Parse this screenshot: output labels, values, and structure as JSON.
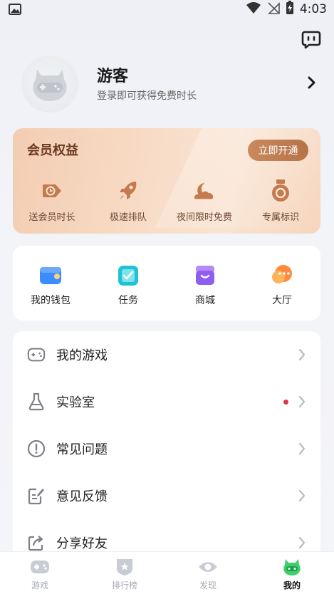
{
  "status_bar": {
    "time": "4:03"
  },
  "profile": {
    "username": "游客",
    "subtitle": "登录即可获得免费时长"
  },
  "member": {
    "title": "会员权益",
    "open_button": "立即开通",
    "perks": [
      {
        "label": "送会员时长",
        "icon": "clock-tag-icon"
      },
      {
        "label": "极速排队",
        "icon": "rocket-icon"
      },
      {
        "label": "夜间限时免费",
        "icon": "moon-cloud-icon"
      },
      {
        "label": "专属标识",
        "icon": "medal-icon"
      }
    ]
  },
  "quick": {
    "items": [
      {
        "label": "我的钱包",
        "icon": "wallet-icon",
        "color": "#2f8cff"
      },
      {
        "label": "任务",
        "icon": "task-icon",
        "color": "#22c4d8"
      },
      {
        "label": "商城",
        "icon": "shop-icon",
        "color": "#9b6cf3"
      },
      {
        "label": "大厅",
        "icon": "chat-hall-icon",
        "color": "#ff8a3d"
      }
    ]
  },
  "menu": {
    "items": [
      {
        "label": "我的游戏",
        "icon": "gamepad-icon"
      },
      {
        "label": "实验室",
        "icon": "flask-icon",
        "badge": true
      },
      {
        "label": "常见问题",
        "icon": "exclamation-circle-icon"
      },
      {
        "label": "意见反馈",
        "icon": "edit-note-icon"
      },
      {
        "label": "分享好友",
        "icon": "share-icon"
      }
    ]
  },
  "bottom_nav": {
    "items": [
      {
        "label": "游戏",
        "icon": "game-tab-icon",
        "active": false
      },
      {
        "label": "排行榜",
        "icon": "rank-tab-icon",
        "active": false
      },
      {
        "label": "发现",
        "icon": "discover-tab-icon",
        "active": false
      },
      {
        "label": "我的",
        "icon": "mine-tab-icon",
        "active": true
      }
    ]
  },
  "colors": {
    "accent_orange": "#b67247",
    "member_text": "#6b3a1f",
    "badge_red": "#e0334a",
    "active_tab": "#3ccf6a"
  }
}
